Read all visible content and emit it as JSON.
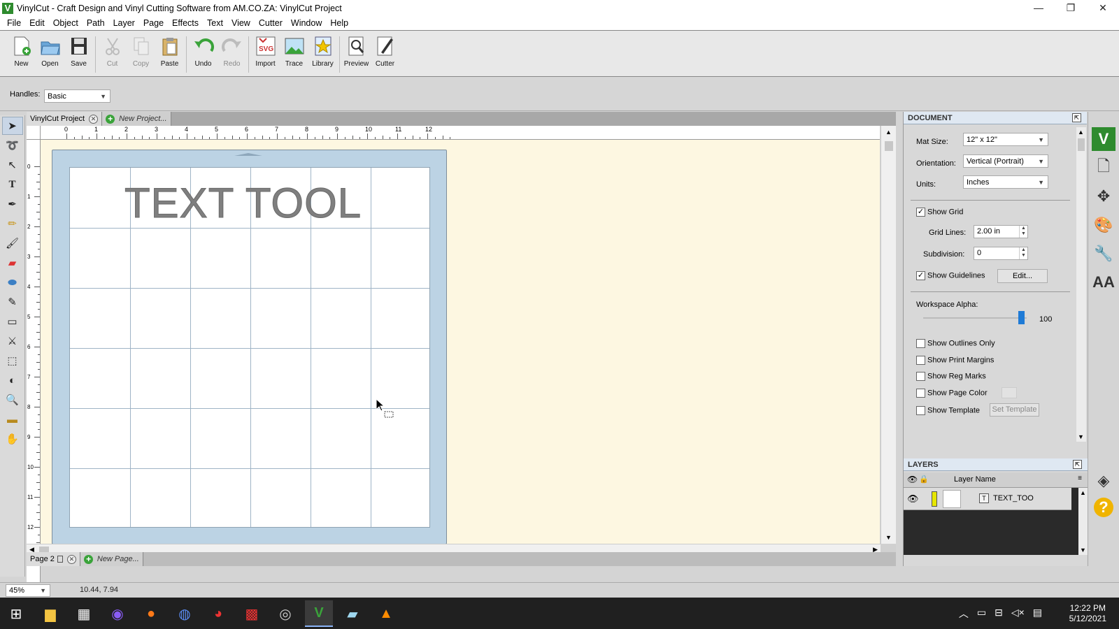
{
  "window": {
    "title": "VinylCut - Craft Design and Vinyl Cutting Software from AM.CO.ZA: VinylCut Project",
    "app_icon_letter": "V",
    "controls": [
      "—",
      "❐",
      "✕"
    ]
  },
  "menu": [
    "File",
    "Edit",
    "Object",
    "Path",
    "Layer",
    "Page",
    "Effects",
    "Text",
    "View",
    "Cutter",
    "Window",
    "Help"
  ],
  "toolbar": {
    "buttons": [
      {
        "label": "New",
        "icon": "new-document-icon"
      },
      {
        "label": "Open",
        "icon": "open-folder-icon"
      },
      {
        "label": "Save",
        "icon": "floppy-disk-icon"
      },
      {
        "label": "Cut",
        "icon": "scissors-icon",
        "disabled": true
      },
      {
        "label": "Copy",
        "icon": "copy-icon",
        "disabled": true
      },
      {
        "label": "Paste",
        "icon": "clipboard-icon"
      },
      {
        "label": "Undo",
        "icon": "undo-arrow-icon"
      },
      {
        "label": "Redo",
        "icon": "redo-arrow-icon",
        "disabled": true
      },
      {
        "label": "Import",
        "icon": "import-svg-icon"
      },
      {
        "label": "Trace",
        "icon": "trace-image-icon"
      },
      {
        "label": "Library",
        "icon": "star-library-icon"
      },
      {
        "label": "Preview",
        "icon": "magnifier-preview-icon"
      },
      {
        "label": "Cutter",
        "icon": "cutter-blade-icon"
      }
    ]
  },
  "handles": {
    "label": "Handles:",
    "value": "Basic"
  },
  "tools": [
    "select-arrow-icon",
    "lasso-icon",
    "node-select-icon",
    "text-tool-icon",
    "pen-tool-icon",
    "pencil-tool-icon",
    "brush-tool-icon",
    "eraser-tool-icon",
    "ellipse-tool-icon",
    "eyedropper-icon",
    "rectangle-tool-icon",
    "knife-tool-icon",
    "transform-icon",
    "contour-icon",
    "zoom-tool-icon",
    "ruler-tool-icon",
    "hand-pan-icon"
  ],
  "doc_tabs": {
    "active": "VinylCut Project",
    "new": "New Project..."
  },
  "ruler": {
    "h_labels": [
      "0",
      "1",
      "2",
      "3",
      "4",
      "5",
      "6",
      "7",
      "8",
      "9",
      "10",
      "11",
      "12"
    ],
    "v_labels": [
      "0",
      "1",
      "2",
      "3",
      "4",
      "5",
      "6",
      "7",
      "8",
      "9",
      "10",
      "11",
      "12"
    ]
  },
  "canvas": {
    "text": "TEXT TOOL"
  },
  "page_tabs": {
    "active": "Page 2",
    "new": "New Page..."
  },
  "status": {
    "zoom": "45%",
    "coords": "10.44, 7.94"
  },
  "document": {
    "heading": "DOCUMENT",
    "mat_size_label": "Mat Size:",
    "mat_size": "12\" x 12\"",
    "orientation_label": "Orientation:",
    "orientation": "Vertical (Portrait)",
    "units_label": "Units:",
    "units": "Inches",
    "show_grid": "Show Grid",
    "show_grid_checked": true,
    "grid_lines_label": "Grid Lines:",
    "grid_lines": "2.00 in",
    "subdivision_label": "Subdivision:",
    "subdivision": "0",
    "show_guidelines": "Show Guidelines",
    "show_guidelines_checked": true,
    "edit_button": "Edit...",
    "workspace_alpha_label": "Workspace Alpha:",
    "workspace_alpha": "100",
    "show_outlines_only": "Show Outlines Only",
    "show_print_margins": "Show Print Margins",
    "show_reg_marks": "Show Reg Marks",
    "show_page_color": "Show Page Color",
    "show_template": "Show Template",
    "set_template_button": "Set Template"
  },
  "layers": {
    "heading": "LAYERS",
    "column": "Layer Name",
    "rows": [
      {
        "name": "TEXT_TOO"
      }
    ]
  },
  "right_strip": [
    "vinylcut-logo-icon",
    "document-page-icon",
    "move-arrows-icon",
    "color-palette-icon",
    "wrench-icon",
    "text-aa-icon",
    "layers-stack-icon",
    "help-question-icon"
  ],
  "taskbar": {
    "time": "12:22 PM",
    "date": "5/12/2021",
    "apps": [
      "windows-start-icon",
      "file-explorer-icon",
      "store-icon",
      "media-player-icon",
      "firefox-icon",
      "browser-icon",
      "chrome-icon",
      "red-app-icon",
      "aperture-icon",
      "vinylcut-icon",
      "notes-icon",
      "vlc-icon"
    ]
  },
  "colors": {
    "accent": "#3aa33a",
    "canvas_bg": "#fdf7e1",
    "mat": "#bcd3e4",
    "grid": "#9fb4c6",
    "text_fill": "#7f7f7f"
  }
}
